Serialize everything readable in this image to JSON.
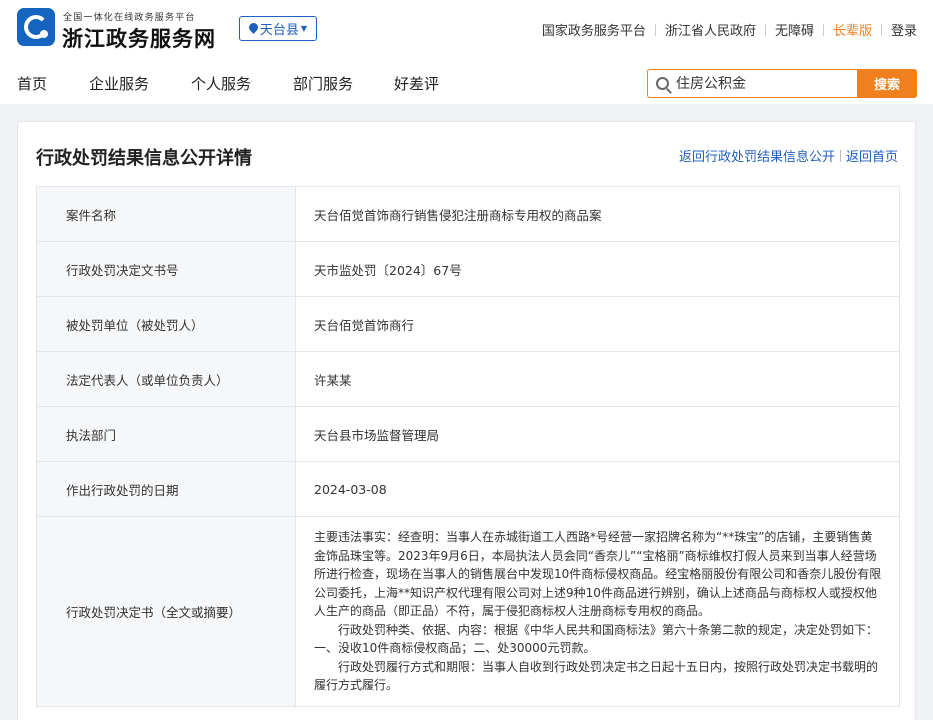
{
  "header": {
    "brand_subtitle": "全国一体化在线政务服务平台",
    "brand_title": "浙江政务服务网",
    "region": "天台县",
    "links": {
      "national": "国家政务服务平台",
      "province": "浙江省人民政府",
      "accessible": "无障碍",
      "elder": "长辈版",
      "login": "登录"
    }
  },
  "nav": {
    "items": [
      "首页",
      "企业服务",
      "个人服务",
      "部门服务",
      "好差评"
    ],
    "search": {
      "placeholder": "住房公积金",
      "button": "搜索"
    }
  },
  "page": {
    "title": "行政处罚结果信息公开详情",
    "back_list": "返回行政处罚结果信息公开",
    "back_home": "返回首页"
  },
  "table": {
    "rows": [
      {
        "label": "案件名称",
        "value": "天台佰觉首饰商行销售侵犯注册商标专用权的商品案"
      },
      {
        "label": "行政处罚决定文书号",
        "value": "天市监处罚〔2024〕67号"
      },
      {
        "label": "被处罚单位（被处罚人）",
        "value": "天台佰觉首饰商行"
      },
      {
        "label": "法定代表人（或单位负责人）",
        "value": "许某某"
      },
      {
        "label": "执法部门",
        "value": "天台县市场监督管理局"
      },
      {
        "label": "作出行政处罚的日期",
        "value": "2024-03-08"
      }
    ],
    "decision": {
      "label": "行政处罚决定书（全文或摘要）",
      "paragraphs": [
        "主要违法事实：经查明：当事人在赤城街道工人西路*号经营一家招牌名称为“**珠宝”的店铺，主要销售黄金饰品珠宝等。2023年9月6日，本局执法人员会同“香奈儿”“宝格丽”商标维权打假人员来到当事人经营场所进行检查，现场在当事人的销售展台中发现10件商标侵权商品。经宝格丽股份有限公司和香奈儿股份有限公司委托，上海**知识产权代理有限公司对上述9种10件商品进行辨别，确认上述商品与商标权人或授权他人生产的商品（即正品）不符，属于侵犯商标权人注册商标专用权的商品。",
        "行政处罚种类、依据、内容：根据《中华人民共和国商标法》第六十条第二款的规定，决定处罚如下：一、没收10件商标侵权商品；二、处30000元罚款。",
        "行政处罚履行方式和期限：当事人自收到行政处罚决定书之日起十五日内，按照行政处罚决定书载明的履行方式履行。"
      ]
    }
  }
}
